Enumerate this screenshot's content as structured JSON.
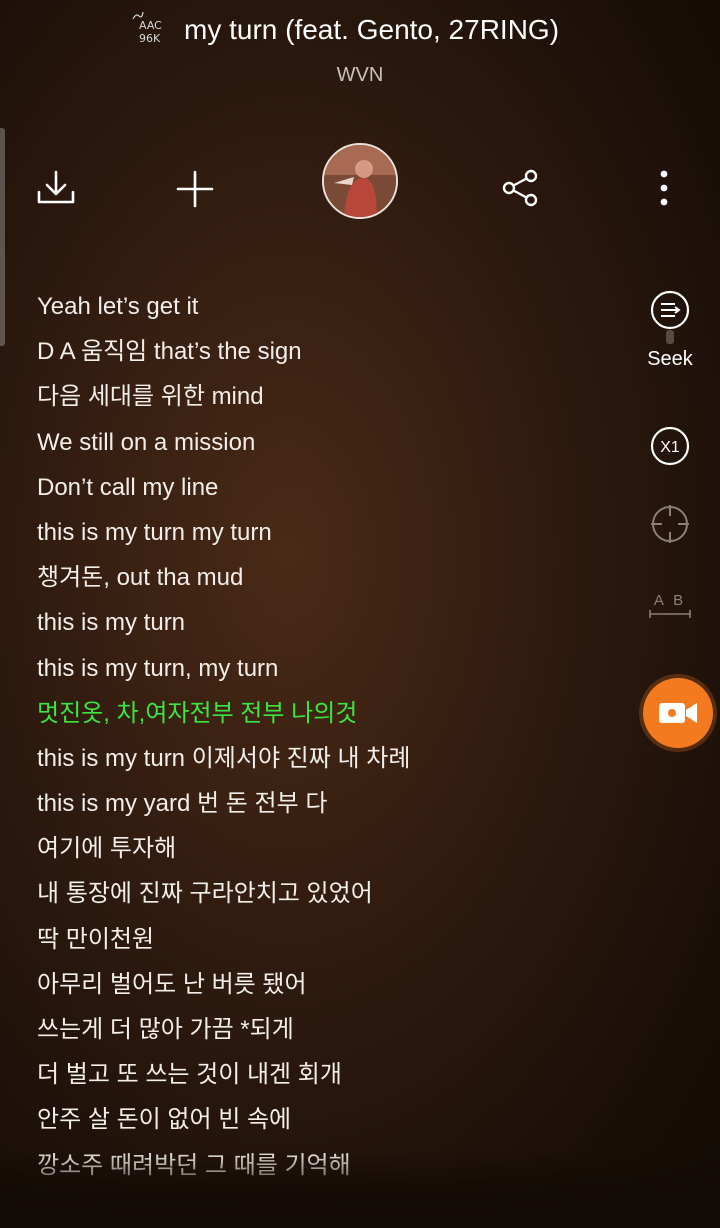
{
  "header": {
    "codec_line1": "AAC",
    "codec_line2": "96K",
    "title": "my turn (feat. Gento, 27RING)",
    "artist": "WVN"
  },
  "toolbar": {
    "download_icon": "download-icon",
    "add_icon": "plus-icon",
    "share_icon": "share-icon",
    "more_icon": "more-vertical-icon"
  },
  "side_panel": {
    "seek_label": "Seek",
    "speed_label": "X1",
    "ab_label": "A B"
  },
  "colors": {
    "active_lyric": "#3ce63c",
    "record_button": "#f47a1f"
  },
  "lyrics": [
    "Yeah let’s get it",
    "D A 움직임 that’s the sign",
    "다음 세대를 위한 mind",
    "We still on a mission",
    "Don’t call my line",
    "this is my turn my turn",
    "챙겨돈, out tha mud",
    "this is my turn",
    "this is my turn, my turn",
    "멋진옷, 차,여자전부 전부 나의것",
    "this is my turn 이제서야 진짜 내 차례",
    "this is my yard 번 돈 전부 다",
    "여기에 투자해",
    "내 통장에 진짜 구라안치고 있었어",
    "딱 만이천원",
    "아무리 벌어도 난 버릇 됐어",
    "쓰는게 더 많아 가끔 *되게",
    "더 벌고 또 쓰는 것이 내겐 회개",
    "안주 살 돈이 없어 빈 속에",
    "깡소주 때려박던 그 때를 기억해"
  ],
  "active_lyric_index": 9
}
